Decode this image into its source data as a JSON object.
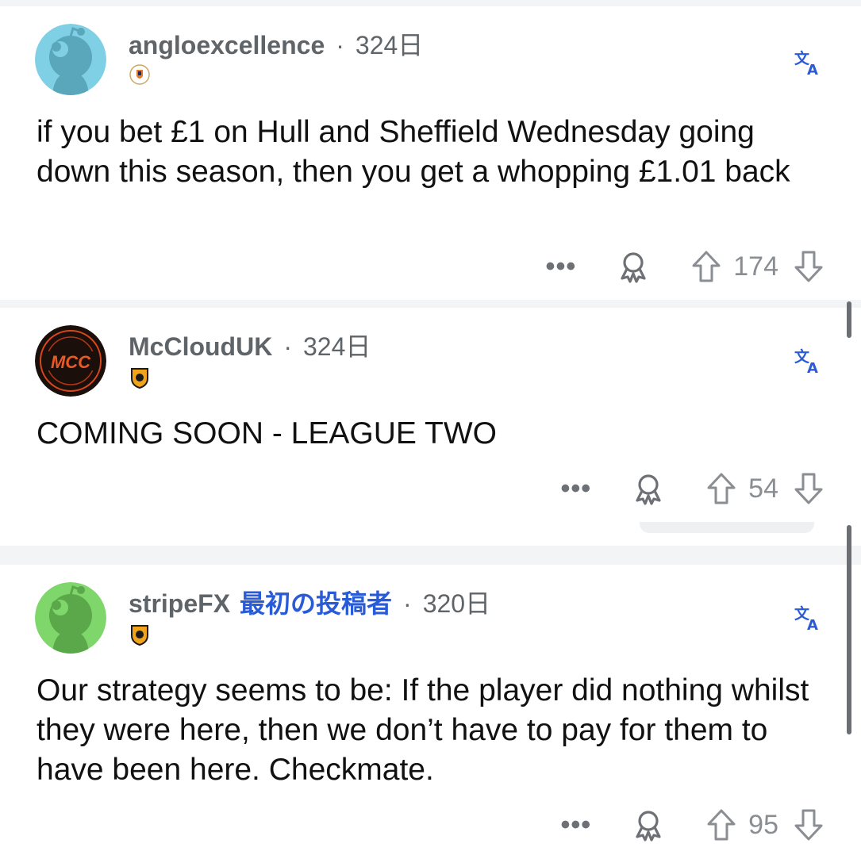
{
  "comments": [
    {
      "username": "angloexcellence",
      "time": "324日",
      "body": "if you bet £1 on Hull and Sheffield Wednesday going down this season, then you get a whopping £1.01 back",
      "score": "174",
      "avatar": "snoo-avatar-blue",
      "flair": "luton-town-badge"
    },
    {
      "username": "McCloudUK",
      "time": "324日",
      "body": "COMING SOON - LEAGUE TWO",
      "score": "54",
      "avatar": "mcc-logo-avatar",
      "avatar_text": "MCC",
      "flair": "hull-city-badge"
    },
    {
      "username": "stripeFX",
      "op_label": "最初の投稿者",
      "time": "320日",
      "body": "Our strategy seems to be: If the player did nothing whilst they were here, then we don’t have to pay for them to have been here. Checkmate.",
      "score": "95",
      "avatar": "snoo-avatar-green",
      "flair": "hull-city-badge"
    }
  ],
  "icons": {
    "translate": "translate-icon",
    "more": "more-options-icon",
    "award": "award-icon",
    "upvote": "upvote-icon",
    "downvote": "downvote-icon"
  },
  "more_glyph": "•••",
  "colors": {
    "accent": "#2a5bd7",
    "meta": "#5f6468",
    "icon_gray": "#8a8e92",
    "avatar_blue_bg": "#7fd0e4",
    "avatar_green_bg": "#7fd66a"
  }
}
